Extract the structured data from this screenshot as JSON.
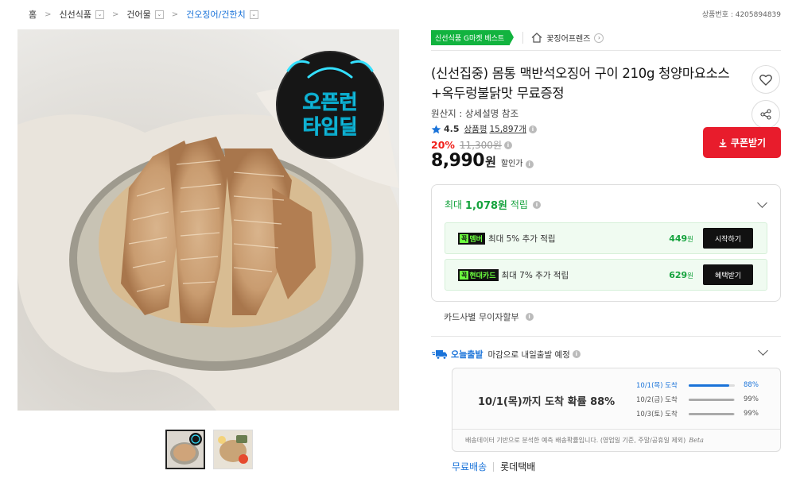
{
  "breadcrumb": {
    "items": [
      {
        "label": "홈",
        "dropdown": false,
        "active": false
      },
      {
        "label": "신선식품",
        "dropdown": true,
        "active": false
      },
      {
        "label": "건어물",
        "dropdown": true,
        "active": false
      },
      {
        "label": "건오징어/건한치",
        "dropdown": true,
        "active": true
      }
    ]
  },
  "product_no": "상품번호 : 4205894839",
  "promo_badge": {
    "line1": "오픈런",
    "line2": "타임딜"
  },
  "badges": {
    "category_best": "신선식품 G마켓 베스트",
    "shop_name": "꽃징어프렌즈"
  },
  "product": {
    "title": "(신선집중) 몸통 맥반석오징어 구이 210g 청양마요소스+옥두렁불닭맛 무료증정",
    "origin": "원산지 : 상세설명 참조",
    "rating": "4.5",
    "review_label": "상품평",
    "review_count": "15,897개",
    "discount_rate": "20%",
    "original_price": "11,300원",
    "sale_price": "8,990",
    "price_unit": "원",
    "price_label": "할인가"
  },
  "coupon_button": "쿠폰받기",
  "points": {
    "prefix": "최대",
    "amount": "1,078원",
    "suffix": "적립",
    "benefits": [
      {
        "tag_k": "꼭",
        "tag": "멤버",
        "text": "최대 5% 추가 적립",
        "amount": "449",
        "unit": "원",
        "button": "시작하기"
      },
      {
        "tag_k": "꼭",
        "tag": "현대카드",
        "text": "최대 7% 추가 적립",
        "amount": "629",
        "unit": "원",
        "button": "혜택받기"
      }
    ]
  },
  "card_installment": "카드사별 무이자할부",
  "delivery": {
    "today_label": "오늘출발",
    "text": "마감으로 내일출발 예정",
    "headline": "10/1(목)까지 도착 확률 88%",
    "rows": [
      {
        "date": "10/1(목) 도착",
        "pct": "88%",
        "value": 0.88,
        "highlight": true
      },
      {
        "date": "10/2(금) 도착",
        "pct": "99%",
        "value": 0.99,
        "highlight": false
      },
      {
        "date": "10/3(토) 도착",
        "pct": "99%",
        "value": 0.99,
        "highlight": false
      }
    ],
    "note": "배송데이터 기반으로 분석한 예측 배송확률입니다. (영업일 기준, 주말/공휴일 제외)",
    "beta": "Beta"
  },
  "shipping": {
    "fee": "무료배송",
    "courier": "롯데택배"
  },
  "colors": {
    "accent_red": "#e81c2c",
    "accent_green": "#16a33e",
    "accent_blue": "#1a73d9",
    "badge_green": "#12b33f"
  }
}
